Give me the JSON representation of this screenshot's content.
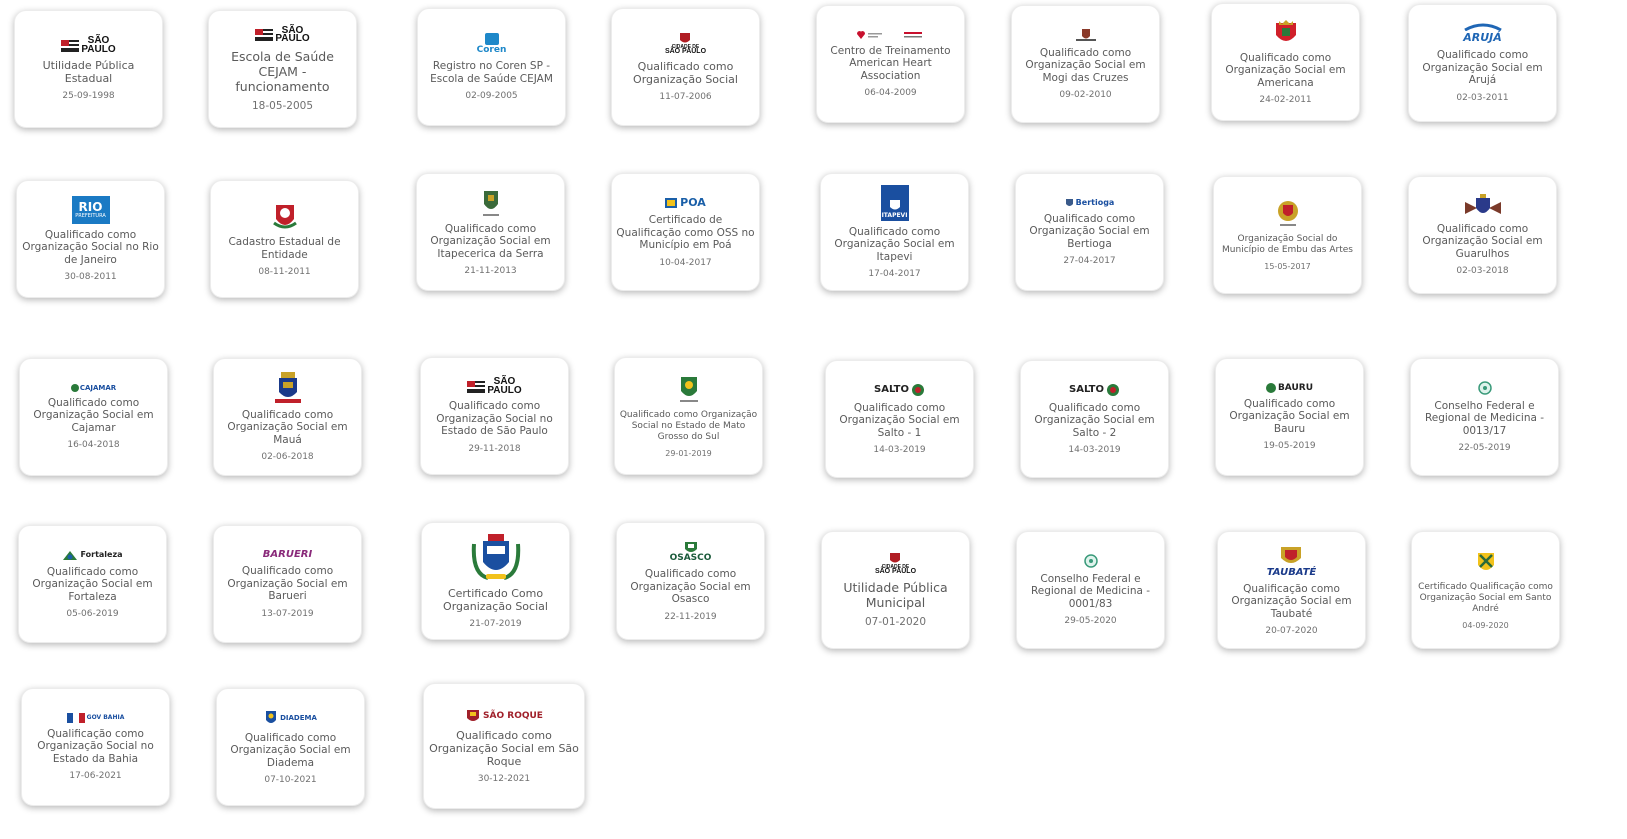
{
  "logo_text": {
    "sp_line1": "SÃO",
    "sp_line2": "PAULO",
    "coren": "Coren",
    "cidade_sp_line1": "CIDADE DE",
    "cidade_sp_line2": "SÃO PAULO",
    "aruja": "ARUJÁ",
    "rio": "RIO",
    "rio_sub": "PREFEITURA",
    "poa": "POA",
    "itapevi": "ITAPEVI",
    "bertioga": "Bertioga",
    "cajamar": "CAJAMAR",
    "salto": "SALTO",
    "bauru": "BAURU",
    "fortaleza": "Fortaleza",
    "barueri": "BARUERI",
    "osasco": "OSASCO",
    "taubate": "TAUBATÉ",
    "bahia": "GOV BAHIA",
    "diadema": "DIADEMA",
    "sao_roque": "SÃO ROQUE"
  },
  "certificates": [
    {
      "title": "Utilidade Pública Estadual",
      "date": "25-09-1998"
    },
    {
      "title": "Escola de Saúde CEJAM - funcionamento",
      "date": "18-05-2005"
    },
    {
      "title": "Registro no Coren SP - Escola de Saúde CEJAM",
      "date": "02-09-2005"
    },
    {
      "title": "Qualificado como Organização Social",
      "date": "11-07-2006"
    },
    {
      "title": "Centro de Treinamento American Heart Association",
      "date": "06-04-2009"
    },
    {
      "title": "Qualificado como Organização Social em Mogi das Cruzes",
      "date": "09-02-2010"
    },
    {
      "title": "Qualificado como Organização Social em Americana",
      "date": "24-02-2011"
    },
    {
      "title": "Qualificado como Organização Social em Arujá",
      "date": "02-03-2011"
    },
    {
      "title": "Qualificado como Organização Social no Rio de Janeiro",
      "date": "30-08-2011"
    },
    {
      "title": "Cadastro Estadual de Entidade",
      "date": "08-11-2011"
    },
    {
      "title": "Qualificado como Organização Social em Itapecerica da Serra",
      "date": "21-11-2013"
    },
    {
      "title": "Certificado de Qualificação como OSS no Município em Poá",
      "date": "10-04-2017"
    },
    {
      "title": "Qualificado como Organização Social em Itapevi",
      "date": "17-04-2017"
    },
    {
      "title": "Qualificado como Organização Social em Bertioga",
      "date": "27-04-2017"
    },
    {
      "title": "Organização Social do Município de Embu das Artes",
      "date": "15-05-2017"
    },
    {
      "title": "Qualificado como Organização Social em Guarulhos",
      "date": "02-03-2018"
    },
    {
      "title": "Qualificado como Organização Social em Cajamar",
      "date": "16-04-2018"
    },
    {
      "title": "Qualificado como Organização Social em Mauá",
      "date": "02-06-2018"
    },
    {
      "title": "Qualificado como Organização Social no Estado de São Paulo",
      "date": "29-11-2018"
    },
    {
      "title": "Qualificado como Organização Social no Estado de Mato Grosso do Sul",
      "date": "29-01-2019"
    },
    {
      "title": "Qualificado como Organização Social em Salto - 1",
      "date": "14-03-2019"
    },
    {
      "title": "Qualificado como Organização Social em Salto - 2",
      "date": "14-03-2019"
    },
    {
      "title": "Qualificado como Organização Social em Bauru",
      "date": "19-05-2019"
    },
    {
      "title": "Conselho Federal e Regional de Medicina - 0013/17",
      "date": "22-05-2019"
    },
    {
      "title": "Qualificado como Organização Social em Fortaleza",
      "date": "05-06-2019"
    },
    {
      "title": "Qualificado como Organização Social em Barueri",
      "date": "13-07-2019"
    },
    {
      "title": "Certificado Como Organização Social",
      "date": "21-07-2019"
    },
    {
      "title": "Qualificado como Organização Social em Osasco",
      "date": "22-11-2019"
    },
    {
      "title": "Utilidade Pública Municipal",
      "date": "07-01-2020"
    },
    {
      "title": "Conselho Federal e Regional de Medicina - 0001/83",
      "date": "29-05-2020"
    },
    {
      "title": "Qualificação como Organização Social em Taubaté",
      "date": "20-07-2020"
    },
    {
      "title": "Certificado Qualificação como Organização Social em Santo André",
      "date": "04-09-2020"
    },
    {
      "title": "Qualificação como Organização Social no Estado da Bahia",
      "date": "17-06-2021"
    },
    {
      "title": "Qualificado como Organização Social em Diadema",
      "date": "07-10-2021"
    },
    {
      "title": "Qualificado como Organização Social em São Roque",
      "date": "30-12-2021"
    }
  ]
}
